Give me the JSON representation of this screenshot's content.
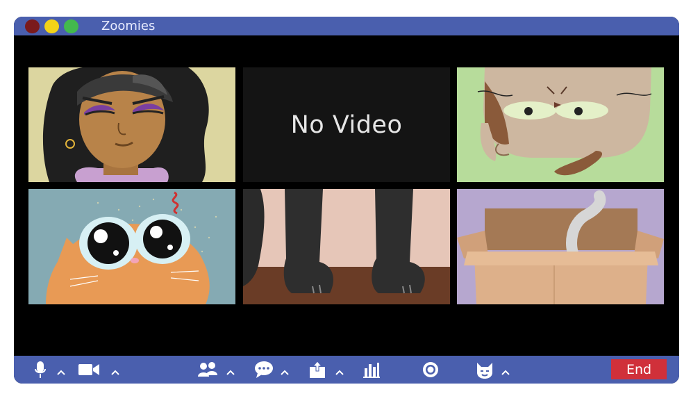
{
  "window": {
    "title": "Zoomies"
  },
  "tiles": {
    "no_video_label": "No Video"
  },
  "toolbar": {
    "end_label": "End",
    "icons": [
      "microphone-icon",
      "video-camera-icon",
      "participants-icon",
      "chat-icon",
      "share-screen-icon",
      "polls-icon",
      "record-icon",
      "reactions-icon"
    ]
  },
  "colors": {
    "titlebar": "#4a5fae",
    "toolbar": "#4a5fae",
    "end_button": "#d0303a",
    "close_dot": "#7a1a1c",
    "minimize_dot": "#f3d319",
    "maximize_dot": "#43b94d"
  }
}
